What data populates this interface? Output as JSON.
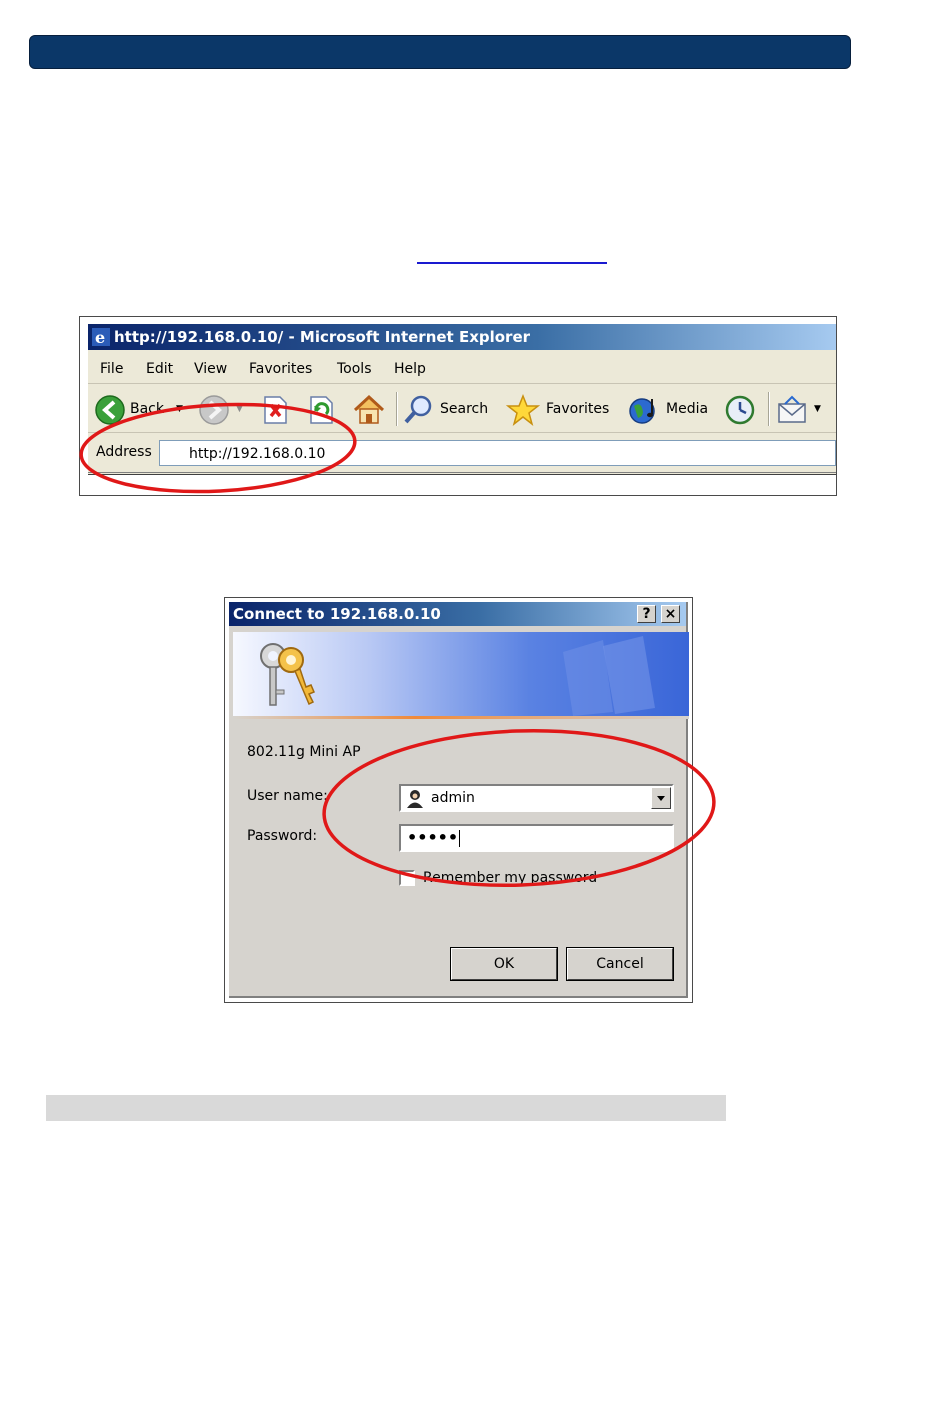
{
  "browser": {
    "title": "http://192.168.0.10/ - Microsoft Internet Explorer",
    "menu": [
      "File",
      "Edit",
      "View",
      "Favorites",
      "Tools",
      "Help"
    ],
    "toolbar": {
      "back": "Back",
      "search": "Search",
      "favorites": "Favorites",
      "media": "Media"
    },
    "address_label": "Address",
    "address_value": "http://192.168.0.10"
  },
  "dialog": {
    "title": "Connect to 192.168.0.10",
    "help_button": "?",
    "close_button": "×",
    "realm": "802.11g Mini AP",
    "username_label": "User name:",
    "username_value": "admin",
    "password_label": "Password:",
    "password_value": "•••••",
    "remember_label": "Remember my password",
    "ok_button": "OK",
    "cancel_button": "Cancel"
  },
  "colors": {
    "header_bar": "#0b3768",
    "highlight_ellipse": "#e01818",
    "gray_bar": "#d9d9d9"
  }
}
